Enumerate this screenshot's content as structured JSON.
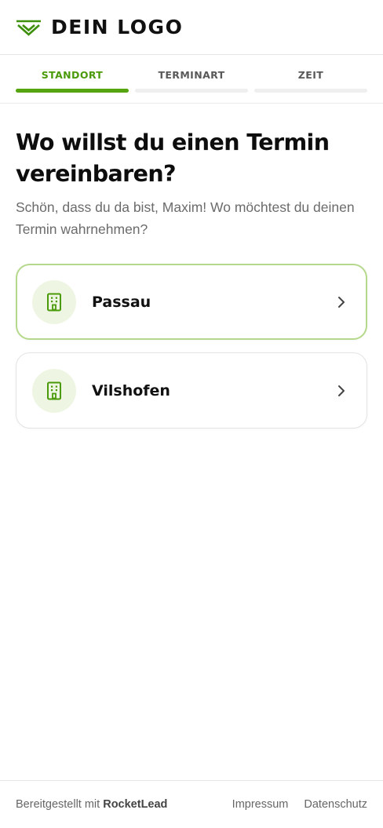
{
  "header": {
    "logo_text": "DEIN LOGO",
    "logo_icon": "chevron-lines-logo-icon",
    "brand_color": "#4a9a0a"
  },
  "steps": [
    {
      "label": "STANDORT",
      "active": true
    },
    {
      "label": "TERMINART",
      "active": false
    },
    {
      "label": "ZEIT",
      "active": false
    }
  ],
  "main": {
    "title": "Wo willst du einen Termin vereinbaren?",
    "subtitle": "Schön, dass du da bist, Maxim! Wo möchtest du deinen Termin wahrnehmen?"
  },
  "locations": [
    {
      "name": "Passau",
      "icon": "building-icon",
      "selected": true
    },
    {
      "name": "Vilshofen",
      "icon": "building-icon",
      "selected": false
    }
  ],
  "footer": {
    "provided_prefix": "Bereitgestellt mit",
    "provider": "RocketLead",
    "impressum": "Impressum",
    "datenschutz": "Datenschutz"
  },
  "colors": {
    "accent": "#56a40f",
    "selected_border": "#b5d98c",
    "icon_bg": "#eef6e3"
  }
}
